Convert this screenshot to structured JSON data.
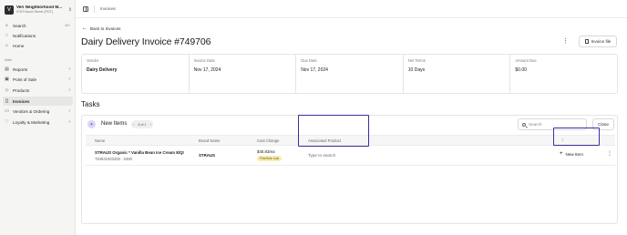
{
  "store": {
    "name": "Veri Neighborhood M...",
    "address": "978 Folsom Street (PDT)",
    "logo": "V"
  },
  "nav": {
    "search": {
      "label": "Search",
      "shortcut": "⌘K"
    },
    "notifications": "Notifications",
    "home": "Home",
    "section": "Main",
    "items": [
      {
        "label": "Reports"
      },
      {
        "label": "Point of Sale"
      },
      {
        "label": "Products"
      },
      {
        "label": "Invoices"
      },
      {
        "label": "Vendors & Ordering"
      },
      {
        "label": "Loyalty & Marketing"
      }
    ]
  },
  "topbar": {
    "breadcrumb": "Invoices"
  },
  "page": {
    "back_label": "Back to Invoices",
    "title": "Dairy Delivery Invoice #749706",
    "invoice_file_label": "Invoice file"
  },
  "meta": [
    {
      "label": "Vendor",
      "value": "Dairy Delivery"
    },
    {
      "label": "Invoice Date",
      "value": "Nov 17, 2024"
    },
    {
      "label": "Due Date",
      "value": "Nov 17, 2024"
    },
    {
      "label": "Net Terms",
      "value": "10 Days"
    },
    {
      "label": "Amount Due",
      "value": "$0.00"
    }
  ],
  "tasks": {
    "title": "Tasks",
    "new_items": {
      "title": "New Items",
      "pager": "8 of 1",
      "search_placeholder": "Search",
      "close_label": "Close",
      "columns": {
        "name": "Name",
        "brand": "Brand Name",
        "cost": "Cost Change",
        "assoc": "Associated Product"
      },
      "rows": [
        {
          "name": "STRAUS Organic * Vanilla Bean Ice Cream 8/Qt",
          "sku": "784831003200 · 0480",
          "brand": "STRAUS",
          "cost": "$40.83/ea",
          "cost_badge": "First time cost",
          "assoc_placeholder": "Type to search",
          "new_item_label": "New Item"
        }
      ]
    }
  }
}
